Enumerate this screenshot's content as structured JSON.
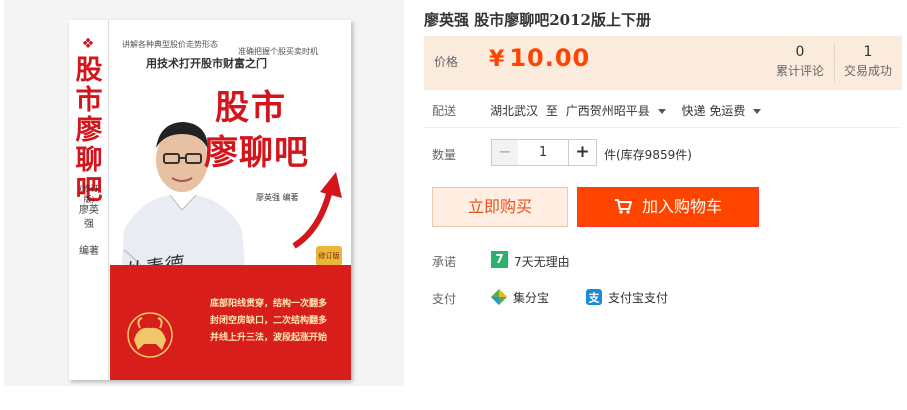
{
  "book": {
    "spine_title": "股市廖聊吧",
    "spine_edition": "(修订版)",
    "spine_author": "廖英强",
    "spine_tag": "编著",
    "tagline_left": "讲解各种典型股价走势形态",
    "tagline_right": "准确把握个股买卖时机",
    "tagline_main": "用技术打开股市财富之门",
    "cover_title_1": "股市",
    "cover_title_2": "廖聊吧",
    "cover_author": "廖英强  编著",
    "seal": "修订版",
    "band_lines": [
      "底部阳线贯穿，结构一次翻多",
      "封闭空房缺口，二次结构翻多",
      "并线上升三法，波段起涨开始"
    ]
  },
  "product": {
    "title": "廖英强 股市廖聊吧2012版上下册"
  },
  "price": {
    "label": "价格",
    "currency": "¥",
    "value": "10.00",
    "color": "#ff4400"
  },
  "stats": [
    {
      "num": "0",
      "label": "累计评论"
    },
    {
      "num": "1",
      "label": "交易成功"
    }
  ],
  "shipping": {
    "label": "配送",
    "from": "湖北武汉",
    "to_word": "至",
    "to": "广西贺州昭平县",
    "method": "快递 免运费"
  },
  "quantity": {
    "label": "数量",
    "minus": "−",
    "value": "1",
    "plus": "+",
    "stock": "件(库存9859件)"
  },
  "actions": {
    "buy": "立即购买",
    "cart": "加入购物车"
  },
  "promise": {
    "label": "承诺",
    "icon_text": "7",
    "text": "7天无理由"
  },
  "payment": {
    "label": "支付",
    "options": [
      {
        "icon": "jifenbao-icon",
        "text": "集分宝"
      },
      {
        "icon": "alipay-icon",
        "text": "支付宝支付"
      }
    ]
  }
}
